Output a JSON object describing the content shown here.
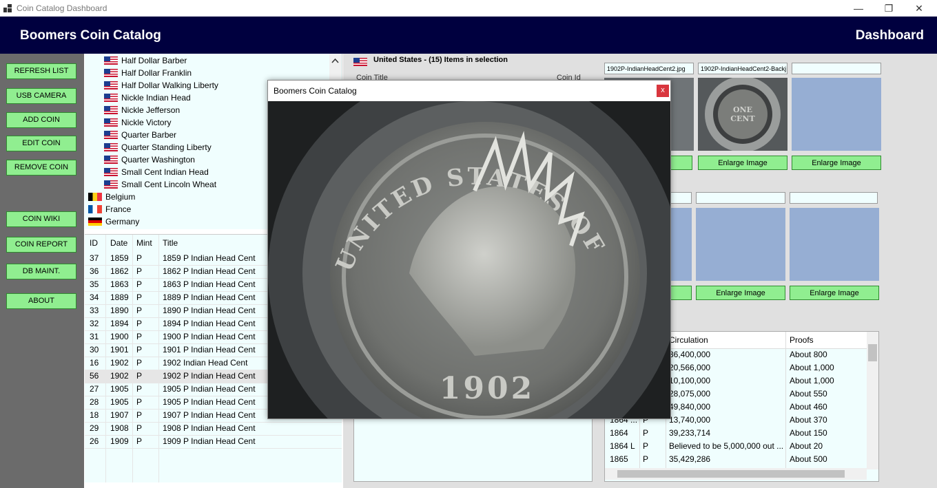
{
  "window": {
    "title": "Coin Catalog Dashboard",
    "minimize": "—",
    "restore": "❐",
    "close": "✕"
  },
  "header": {
    "brand": "Boomers Coin Catalog",
    "page": "Dashboard"
  },
  "sidebar": {
    "refresh": "REFRESH LIST",
    "usb": "USB CAMERA",
    "add": "ADD COIN",
    "edit": "EDIT COIN",
    "remove": "REMOVE COIN",
    "wiki": "COIN WIKI",
    "report": "COIN REPORT",
    "db": "DB MAINT.",
    "about": "ABOUT"
  },
  "tree": {
    "items": [
      "Half Dollar Barber",
      "Half Dollar Franklin",
      "Half Dollar Walking Liberty",
      "Nickle Indian Head",
      "Nickle Jefferson",
      "Nickle Victory",
      "Quarter Barber",
      "Quarter Standing Liberty",
      "Quarter Washington",
      "Small Cent Indian Head",
      "Small Cent Lincoln Wheat"
    ],
    "countries": [
      "Belgium",
      "France",
      "Germany"
    ]
  },
  "list": {
    "headers": {
      "id": "ID",
      "date": "Date",
      "mint": "Mint",
      "title": "Title"
    },
    "rows": [
      {
        "id": "37",
        "date": "1859",
        "mint": "P",
        "title": "1859 P Indian Head Cent"
      },
      {
        "id": "36",
        "date": "1862",
        "mint": "P",
        "title": "1862 P Indian Head Cent"
      },
      {
        "id": "35",
        "date": "1863",
        "mint": "P",
        "title": "1863 P Indian Head Cent"
      },
      {
        "id": "34",
        "date": "1889",
        "mint": "P",
        "title": "1889 P Indian Head Cent"
      },
      {
        "id": "33",
        "date": "1890",
        "mint": "P",
        "title": "1890 P Indian Head Cent"
      },
      {
        "id": "32",
        "date": "1894",
        "mint": "P",
        "title": "1894 P Indian Head Cent"
      },
      {
        "id": "31",
        "date": "1900",
        "mint": "P",
        "title": "1900 P Indian Head Cent"
      },
      {
        "id": "30",
        "date": "1901",
        "mint": "P",
        "title": "1901 P Indian Head Cent"
      },
      {
        "id": "16",
        "date": "1902",
        "mint": "P",
        "title": "1902 Indian Head Cent"
      },
      {
        "id": "56",
        "date": "1902",
        "mint": "P",
        "title": "1902 P Indian Head Cent"
      },
      {
        "id": "27",
        "date": "1905",
        "mint": "P",
        "title": "1905 P Indian Head Cent"
      },
      {
        "id": "28",
        "date": "1905",
        "mint": "P",
        "title": "1905 P Indian Head Cent"
      },
      {
        "id": "18",
        "date": "1907",
        "mint": "P",
        "title": "1907 P Indian Head Cent"
      },
      {
        "id": "29",
        "date": "1908",
        "mint": "P",
        "title": "1908 P Indian Head Cent"
      },
      {
        "id": "26",
        "date": "1909",
        "mint": "P",
        "title": "1909 P Indian Head Cent"
      }
    ]
  },
  "selection": {
    "text": "United States - (15) Items in selection",
    "col1": "Coin Title",
    "col2": "Coin Id"
  },
  "images": {
    "top_files": [
      "1902P-IndianHeadCent2.jpg",
      "1902P-IndianHeadCent2-Backj",
      ""
    ],
    "enlarge": "Enlarge Image",
    "enlarge_partial": "e"
  },
  "mintage": {
    "headers": {
      "circulation": "Circulation",
      "proofs": "Proofs"
    },
    "rows": [
      {
        "year": "",
        "mint": "",
        "circ": "36,400,000",
        "proofs": "About 800"
      },
      {
        "year": "",
        "mint": "",
        "circ": "20,566,000",
        "proofs": "About 1,000"
      },
      {
        "year": "",
        "mint": "",
        "circ": "10,100,000",
        "proofs": "About 1,000"
      },
      {
        "year": "",
        "mint": "",
        "circ": "28,075,000",
        "proofs": "About 550"
      },
      {
        "year": "",
        "mint": "",
        "circ": "49,840,000",
        "proofs": "About 460"
      },
      {
        "year": "1864 ...",
        "mint": "P",
        "circ": "13,740,000",
        "proofs": "About 370"
      },
      {
        "year": "1864",
        "mint": "P",
        "circ": "39,233,714",
        "proofs": "About 150"
      },
      {
        "year": "1864 L",
        "mint": "P",
        "circ": "Believed to be 5,000,000 out ...",
        "proofs": "About 20"
      },
      {
        "year": "1865",
        "mint": "P",
        "circ": "35,429,286",
        "proofs": "About 500"
      }
    ]
  },
  "modal": {
    "title": "Boomers Coin Catalog",
    "close": "x",
    "coin_legend": "UNITED STATES OF AMERICA",
    "coin_year": "1902"
  }
}
